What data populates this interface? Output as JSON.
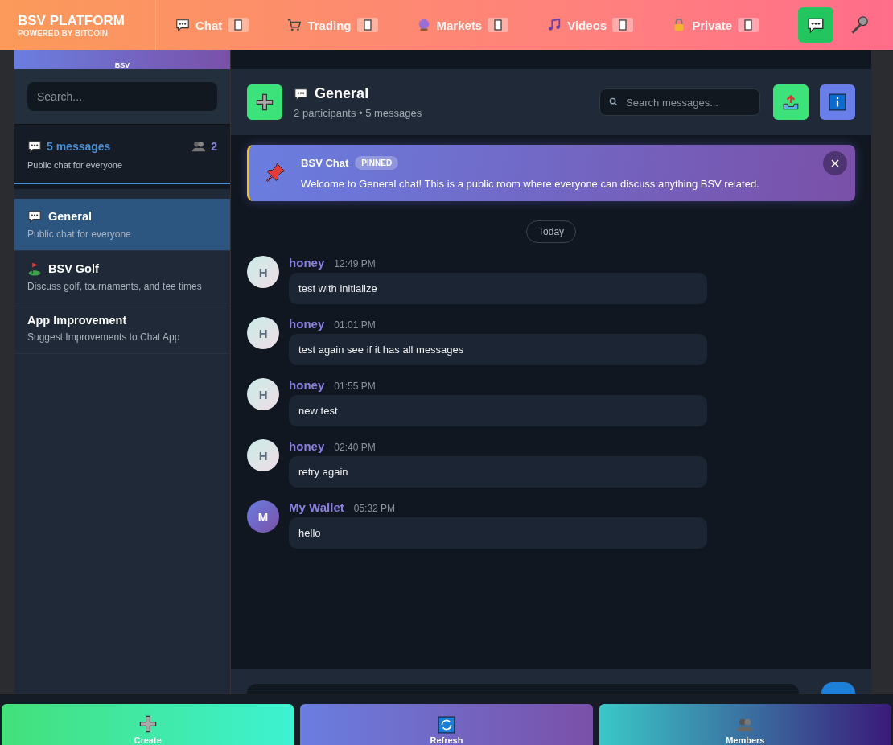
{
  "brand": {
    "title": "BSV PLATFORM",
    "subtitle": "POWERED BY BITCOIN"
  },
  "nav": [
    {
      "label": "Chat",
      "selected": false
    },
    {
      "label": "Trading",
      "selected": false
    },
    {
      "label": "Markets",
      "selected": false
    },
    {
      "label": "Videos",
      "selected": false
    },
    {
      "label": "Private",
      "selected": false
    }
  ],
  "sidebar": {
    "banner": "BSV",
    "search": {
      "placeholder": "Search..."
    },
    "summary": {
      "messages": "5 messages",
      "members": "2",
      "description": "Public chat for everyone"
    },
    "rooms": [
      {
        "name": "General",
        "description": "Public chat for everyone",
        "selected": true
      },
      {
        "name": "BSV Golf",
        "description": "Discuss golf, tournaments, and tee times",
        "selected": false
      },
      {
        "name": "App Improvement",
        "description": "Suggest Improvements to Chat App",
        "selected": false
      }
    ]
  },
  "room": {
    "title": "General",
    "meta": "2 participants • 5 messages",
    "search": {
      "placeholder": "Search messages..."
    }
  },
  "pinned": {
    "author": "BSV Chat",
    "badge": "PINNED",
    "text": "Welcome to General chat! This is a public room where everyone can discuss anything BSV related."
  },
  "date_divider": "Today",
  "messages": [
    {
      "initial": "H",
      "author": "honey",
      "time": "12:49 PM",
      "text": "test with initialize",
      "kind": "light"
    },
    {
      "initial": "H",
      "author": "honey",
      "time": "01:01 PM",
      "text": "test again see if it has all messages",
      "kind": "light"
    },
    {
      "initial": "H",
      "author": "honey",
      "time": "01:55 PM",
      "text": "new test",
      "kind": "light"
    },
    {
      "initial": "H",
      "author": "honey",
      "time": "02:40 PM",
      "text": "retry again",
      "kind": "light"
    },
    {
      "initial": "M",
      "author": "My Wallet",
      "time": "05:32 PM",
      "text": "hello",
      "kind": "purple"
    }
  ],
  "actions": [
    {
      "label": "Create"
    },
    {
      "label": "Refresh"
    },
    {
      "label": "Members"
    }
  ]
}
